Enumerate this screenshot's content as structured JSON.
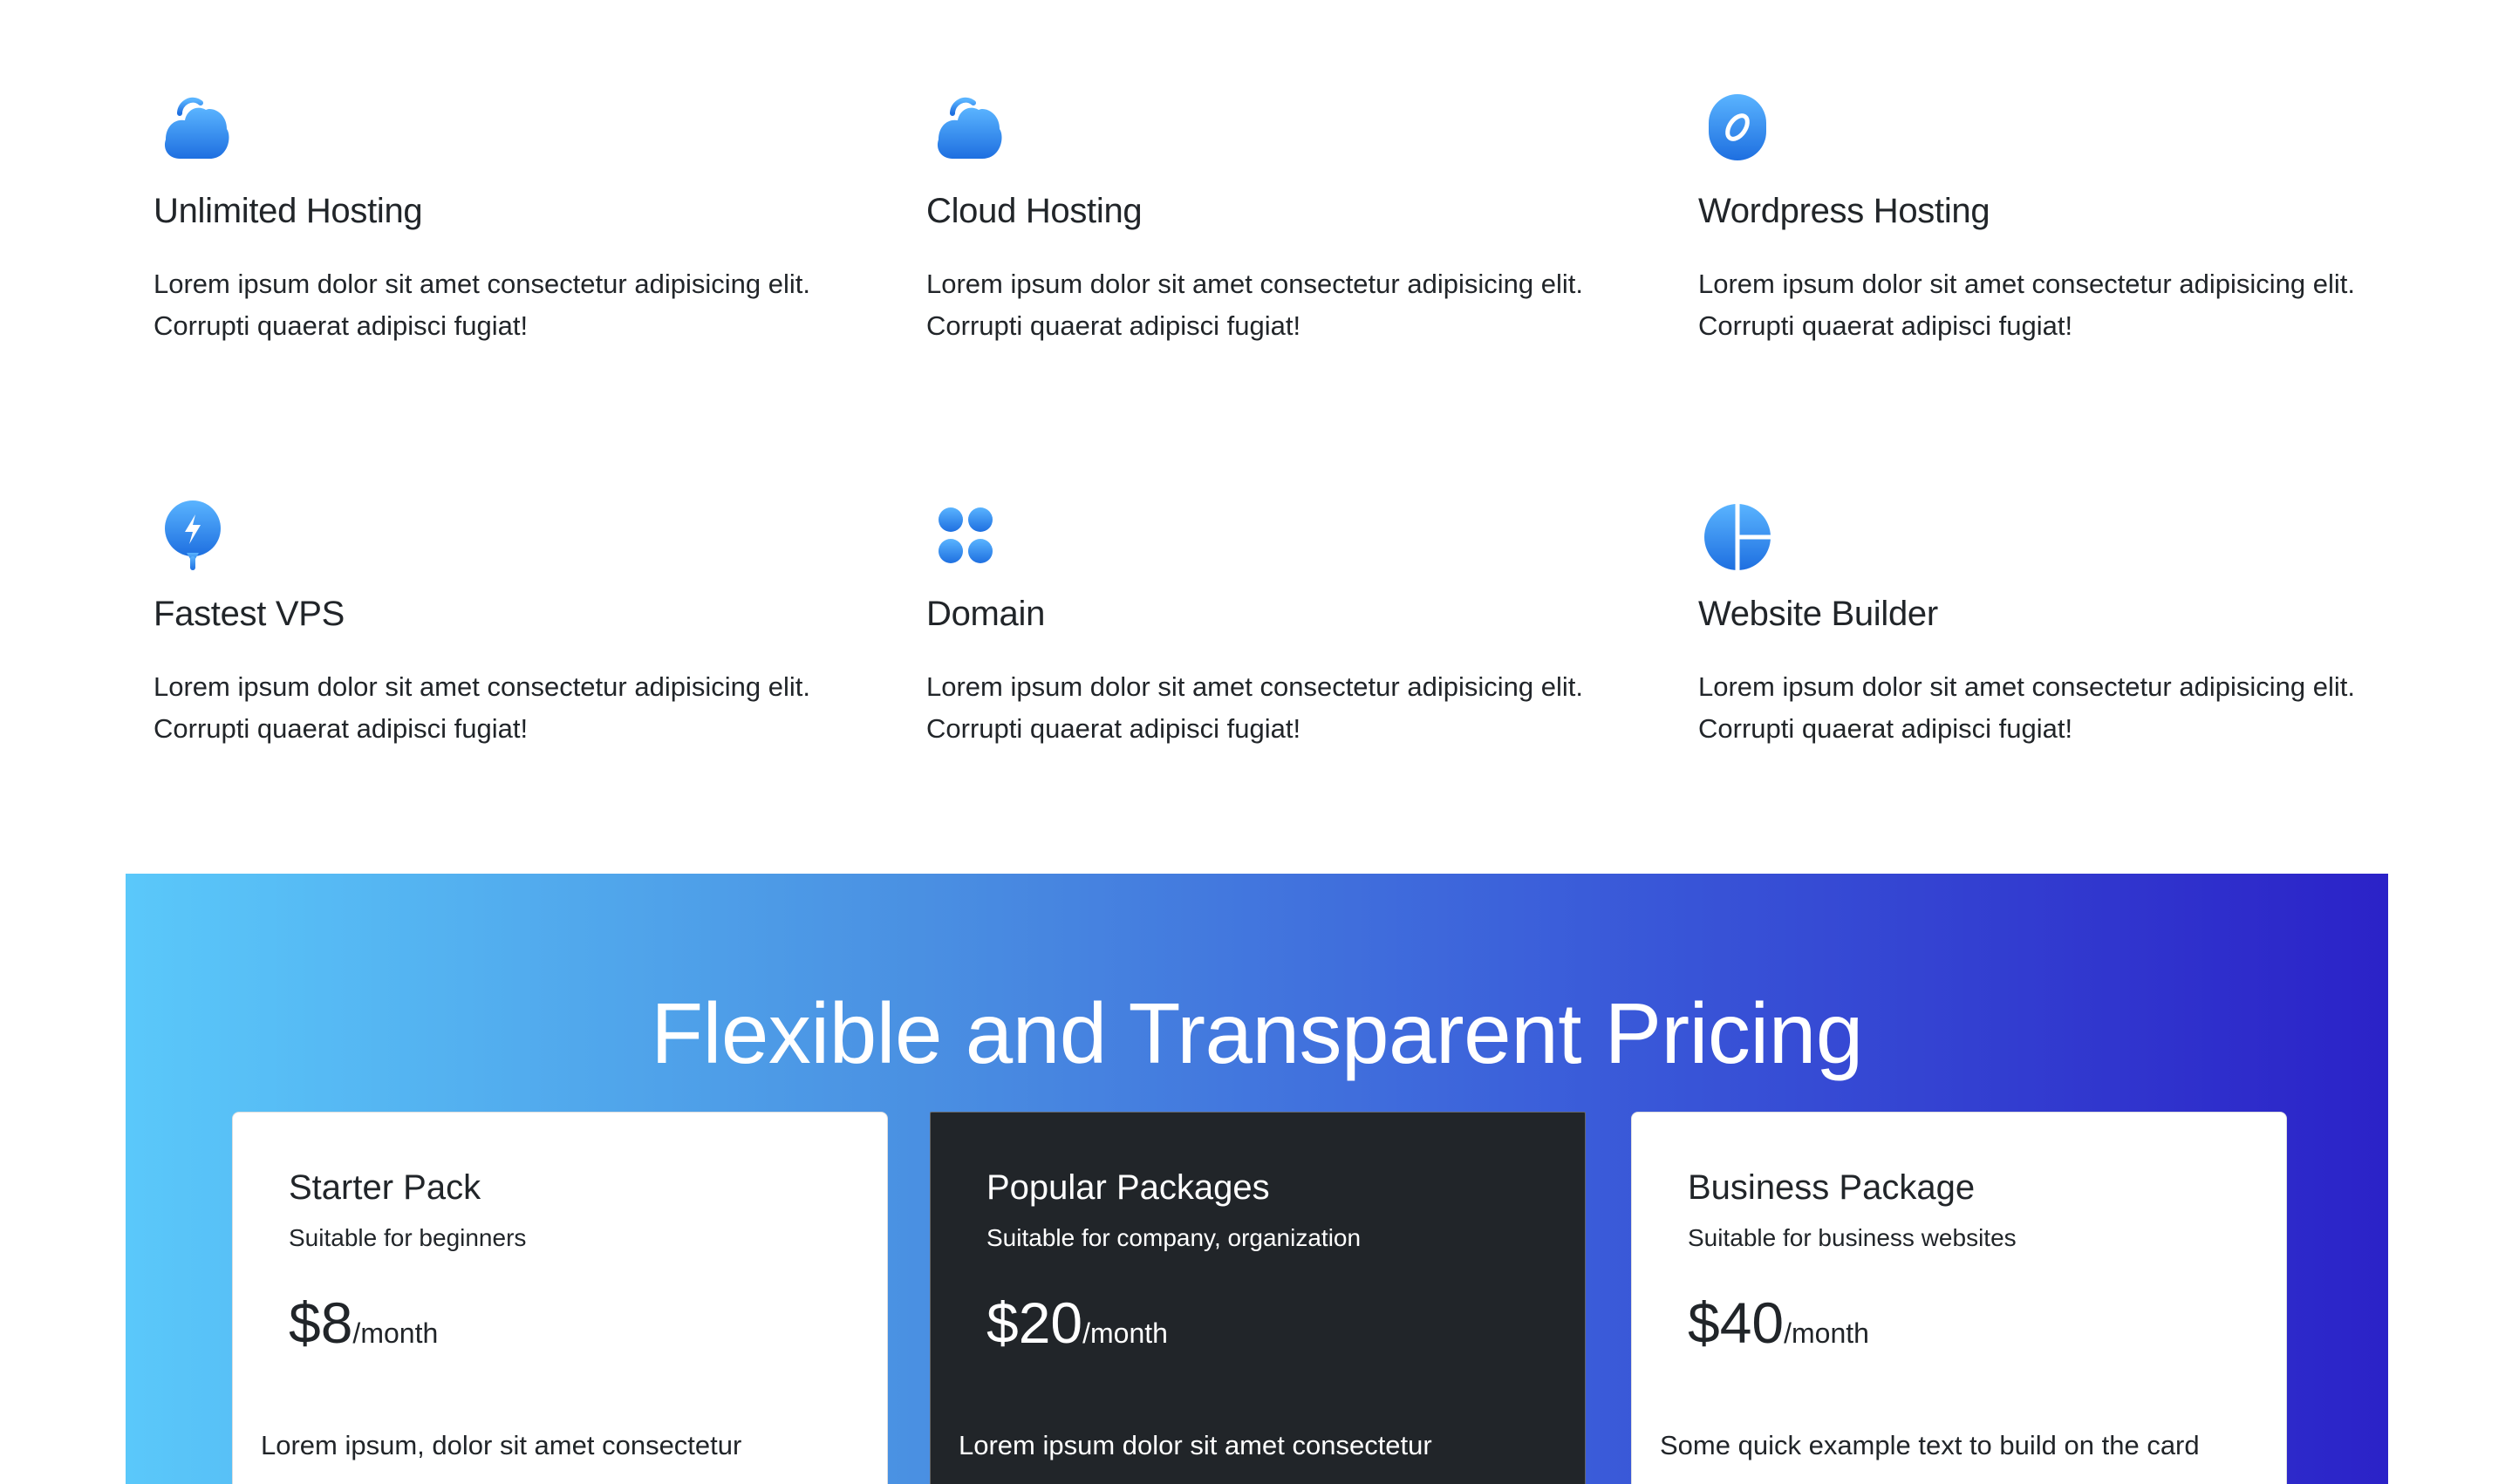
{
  "features": [
    {
      "icon": "cloud-icon",
      "title": "Unlimited Hosting",
      "text": "Lorem ipsum dolor sit amet consectetur adipisicing elit. Corrupti quaerat adipisci fugiat!"
    },
    {
      "icon": "cloud-icon",
      "title": "Cloud Hosting",
      "text": "Lorem ipsum dolor sit amet consectetur adipisicing elit. Corrupti quaerat adipisci fugiat!"
    },
    {
      "icon": "wordpress-leaf-icon",
      "title": "Wordpress Hosting",
      "text": "Lorem ipsum dolor sit amet consectetur adipisicing elit. Corrupti quaerat adipisci fugiat!"
    },
    {
      "icon": "bolt-pin-icon",
      "title": "Fastest VPS",
      "text": "Lorem ipsum dolor sit amet consectetur adipisicing elit. Corrupti quaerat adipisci fugiat!"
    },
    {
      "icon": "grid-dots-icon",
      "title": "Domain",
      "text": "Lorem ipsum dolor sit amet consectetur adipisicing elit. Corrupti quaerat adipisci fugiat!"
    },
    {
      "icon": "pie-chart-icon",
      "title": "Website Builder",
      "text": "Lorem ipsum dolor sit amet consectetur adipisicing elit. Corrupti quaerat adipisci fugiat!"
    }
  ],
  "pricing": {
    "heading": "Flexible and Transparent Pricing",
    "cards": [
      {
        "title": "Starter Pack",
        "subtitle": "Suitable for beginners",
        "price": "$8",
        "per": "/month",
        "body": "Lorem ipsum, dolor sit amet consectetur"
      },
      {
        "title": "Popular Packages",
        "subtitle": "Suitable for company, organization",
        "price": "$20",
        "per": "/month",
        "body": "Lorem ipsum dolor sit amet consectetur"
      },
      {
        "title": "Business Package",
        "subtitle": "Suitable for business websites",
        "price": "$40",
        "per": "/month",
        "body": "Some quick example text to build on the card"
      }
    ]
  },
  "colors": {
    "icon_gradient_start": "#5ab4ff",
    "icon_gradient_end": "#1e6fe0",
    "pricing_gradient_start": "#5ac8fa",
    "pricing_gradient_end": "#2b22c8",
    "dark_card": "#212529"
  }
}
